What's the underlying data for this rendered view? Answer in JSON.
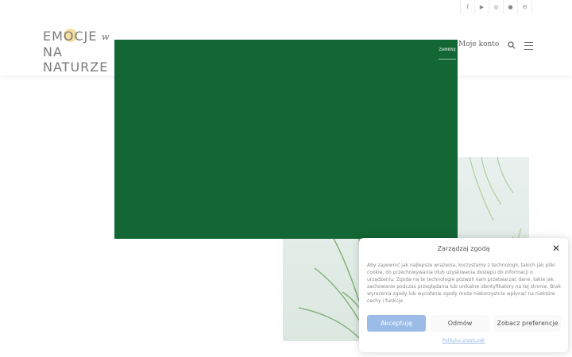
{
  "topbar": {
    "social": [
      {
        "icon": "facebook-icon",
        "glyph": "f"
      },
      {
        "icon": "youtube-icon",
        "glyph": "▶"
      },
      {
        "icon": "instagram-icon",
        "glyph": "◎"
      },
      {
        "icon": "messenger-icon",
        "glyph": "●"
      },
      {
        "icon": "email-icon",
        "glyph": "✉"
      }
    ]
  },
  "header": {
    "logo_line1": "EMOCJE",
    "logo_line2": "NA NATURZE",
    "logo_w": "w",
    "account_label": "Moje konto"
  },
  "modal": {
    "close_label": "ZAMKNIJ",
    "color": "#136734"
  },
  "cookie": {
    "title": "Zarządzaj zgodą",
    "text": "Aby zapewnić jak najlepsze wrażenia, korzystamy z technologii, takich jak pliki cookie, do przechowywania i/lub uzyskiwania dostępu do informacji o urządzeniu. Zgoda na te technologie pozwoli nam przetwarzać dane, takie jak zachowanie podczas przeglądania lub unikalne identyfikatory na tej stronie. Brak wyrażenia zgody lub wycofanie zgody może niekorzystnie wpłynąć na niektóre cechy i funkcje.",
    "accept_label": "Akceptuję",
    "deny_label": "Odmów",
    "prefs_label": "Zobacz preferencje",
    "policy_label": "Polityka plastczek",
    "accent": "#9bbce6"
  }
}
